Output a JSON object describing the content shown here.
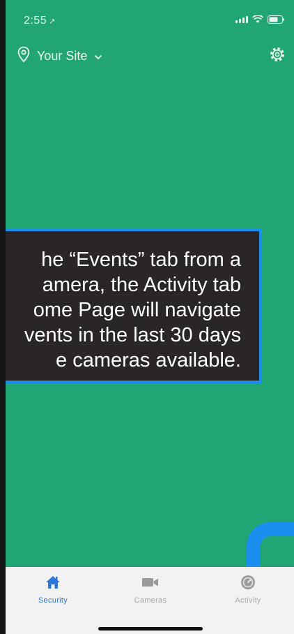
{
  "status_bar": {
    "time": "2:55",
    "location_arrow": "↗"
  },
  "header": {
    "site_label": "Your Site"
  },
  "callout": {
    "text": "he “Events” tab from a\namera, the Activity tab\nome Page will navigate\nvents in the last 30 days\ne cameras available."
  },
  "tabs": [
    {
      "label": "Security",
      "icon": "home-icon",
      "active": true
    },
    {
      "label": "Cameras",
      "icon": "camera-icon",
      "active": false
    },
    {
      "label": "Activity",
      "icon": "activity-icon",
      "active": false
    }
  ],
  "colors": {
    "background": "#22a574",
    "accent": "#1a8ff0",
    "active_tab": "#2f78d6",
    "callout_bg": "#2b2626"
  }
}
